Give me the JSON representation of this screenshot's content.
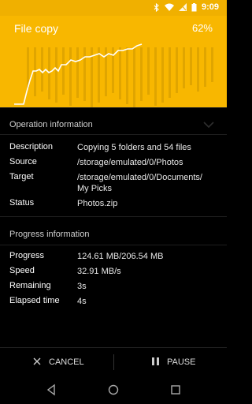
{
  "status_bar": {
    "time": "9:09",
    "icons": [
      "bluetooth-icon",
      "wifi-icon",
      "signal-icon",
      "battery-icon"
    ]
  },
  "header": {
    "title": "File copy",
    "percent": "62%",
    "accent": "#f8b700",
    "progress": 0.62
  },
  "operation": {
    "section_title": "Operation information",
    "rows": [
      {
        "label": "Description",
        "value": "Copying 5 folders and 54 files"
      },
      {
        "label": "Source",
        "value": "/storage/emulated/0/Photos"
      },
      {
        "label": "Target",
        "value": "/storage/emulated/0/Documents/\nMy Picks"
      },
      {
        "label": "Status",
        "value": "Photos.zip"
      }
    ]
  },
  "progress": {
    "section_title": "Progress information",
    "rows": [
      {
        "label": "Progress",
        "value": "124.61 MB/206.54 MB"
      },
      {
        "label": "Speed",
        "value": "32.91 MB/s"
      },
      {
        "label": "Remaining",
        "value": "3s"
      },
      {
        "label": "Elapsed time",
        "value": "4s"
      }
    ]
  },
  "actions": {
    "cancel_label": "CANCEL",
    "pause_label": "PAUSE"
  },
  "navigation": {
    "icons": [
      "back-icon",
      "home-icon",
      "recents-icon"
    ]
  }
}
